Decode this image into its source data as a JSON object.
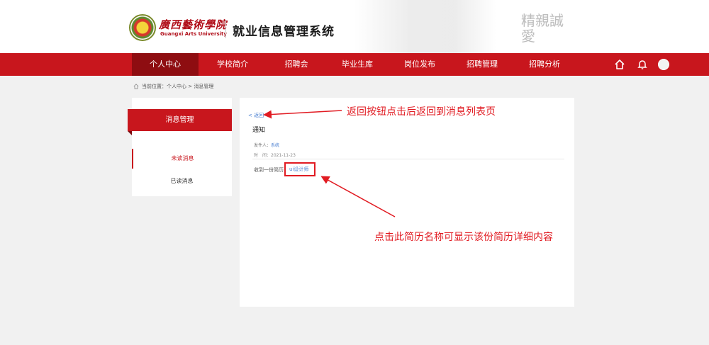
{
  "header": {
    "school_name_cn": "廣西藝術學院",
    "school_name_en": "Guangxi Arts University",
    "system_title": "就业信息管理系统",
    "motto": "精親誠愛"
  },
  "nav": {
    "items": [
      {
        "label": "个人中心",
        "active": true
      },
      {
        "label": "学校简介",
        "active": false
      },
      {
        "label": "招聘会",
        "active": false
      },
      {
        "label": "毕业生库",
        "active": false
      },
      {
        "label": "岗位发布",
        "active": false
      },
      {
        "label": "招聘管理",
        "active": false
      },
      {
        "label": "招聘分析",
        "active": false
      }
    ],
    "icons": [
      "home-icon",
      "bell-icon",
      "avatar"
    ]
  },
  "breadcrumb": {
    "text": "当前位置：个人中心 > 消息管理"
  },
  "sidebar": {
    "title": "消息管理",
    "items": [
      {
        "label": "未读消息",
        "active": true
      },
      {
        "label": "已读消息",
        "active": false
      }
    ]
  },
  "message": {
    "back_label": "< 返回",
    "title": "通知",
    "sender_label": "发件人：",
    "sender_value": "系统",
    "time_label": "时　间：",
    "time_value": "2021-11-23",
    "body_prefix": "收到一份简历",
    "resume_name": "ui设计师"
  },
  "annotations": {
    "top": "返回按钮点击后返回到消息列表页",
    "bottom": "点击此简历名称可显示该份简历详细内容"
  },
  "colors": {
    "brand_red": "#c8161d",
    "nav_active": "#8e0d11",
    "annotation_red": "#e11b22",
    "link_blue": "#4a7fd0"
  }
}
